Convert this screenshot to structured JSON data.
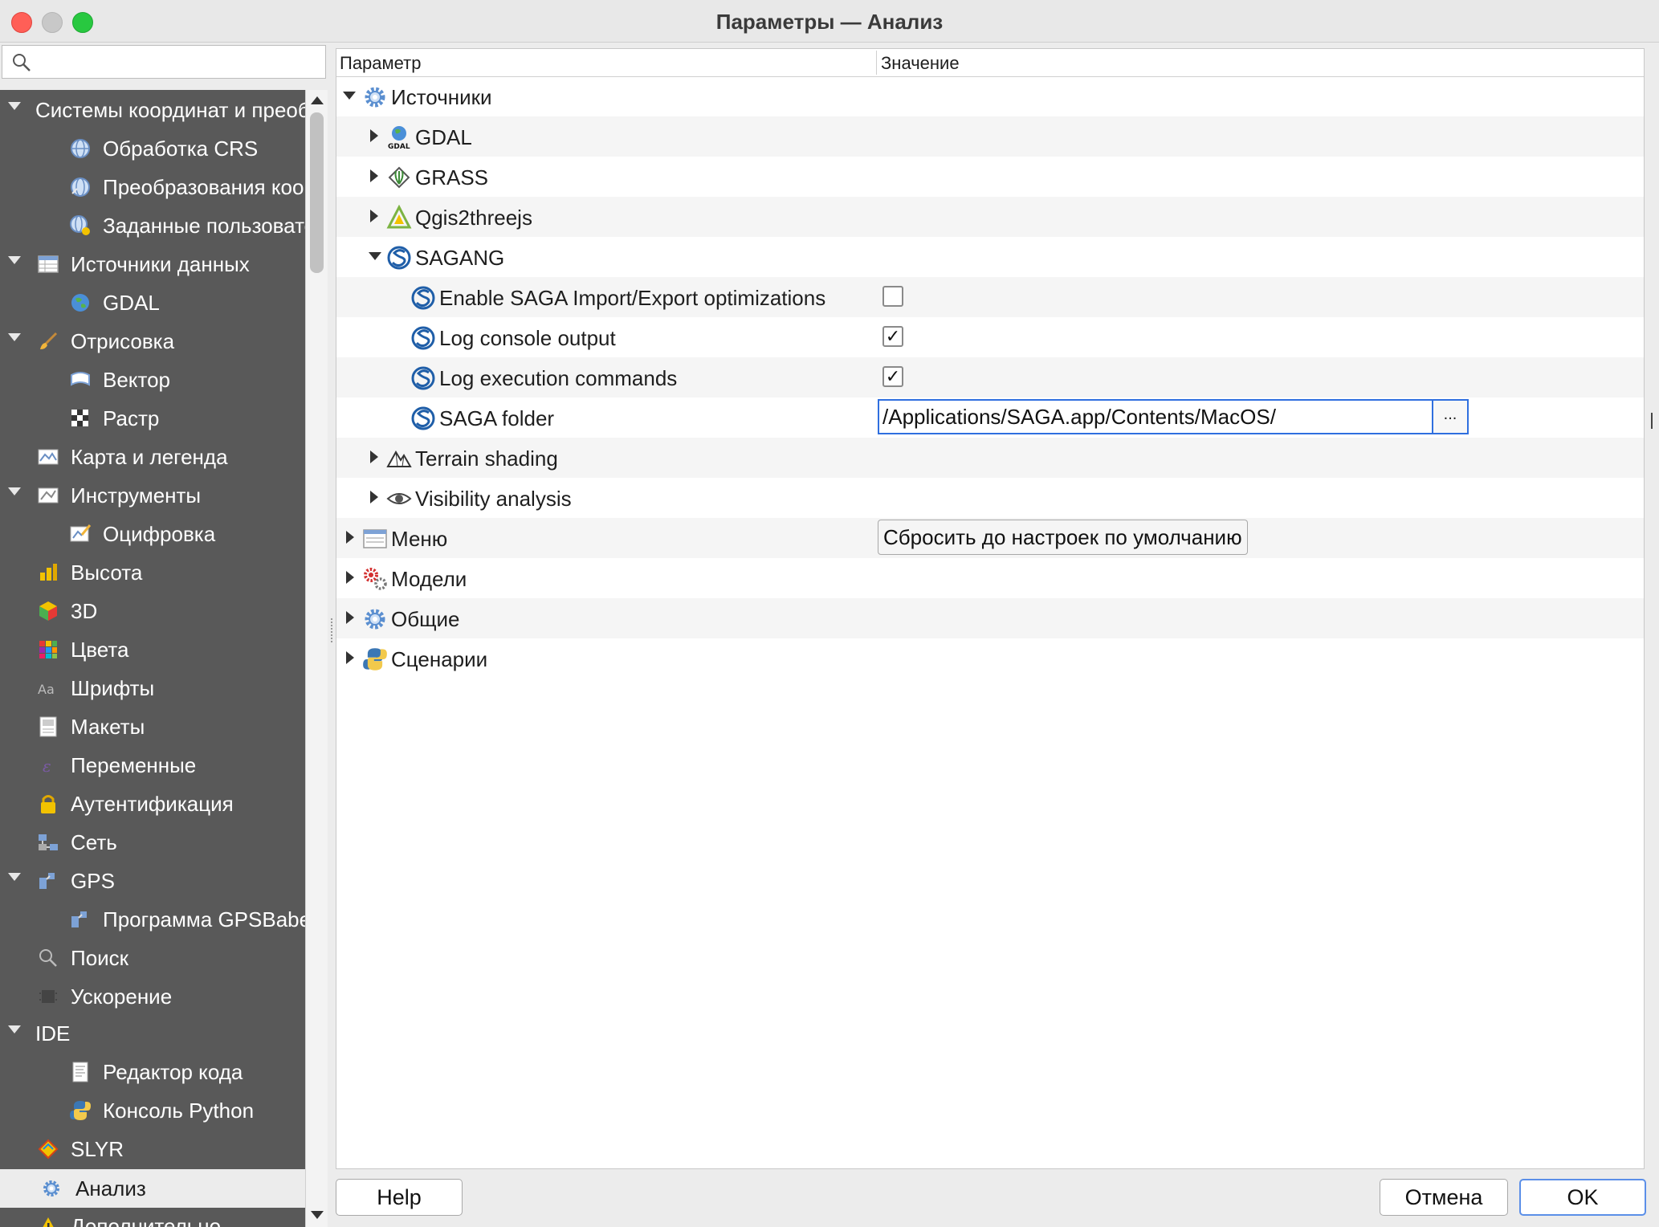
{
  "window": {
    "title": "Параметры — Анализ"
  },
  "search": {
    "placeholder": ""
  },
  "sidebar": {
    "items": [
      {
        "label": "Системы координат и преоб",
        "icon": "crs-icon",
        "expanded": true
      },
      {
        "label": "Обработка CRS",
        "icon": "globe-icon"
      },
      {
        "label": "Преобразования координат",
        "icon": "globe-transform-icon"
      },
      {
        "label": "Заданные пользователем",
        "icon": "globe-star-icon"
      },
      {
        "label": "Источники данных",
        "icon": "table-icon",
        "expanded": true
      },
      {
        "label": "GDAL",
        "icon": "gdal-globe-icon"
      },
      {
        "label": "Отрисовка",
        "icon": "brush-icon",
        "expanded": true
      },
      {
        "label": "Вектор",
        "icon": "vector-icon"
      },
      {
        "label": "Растр",
        "icon": "raster-icon"
      },
      {
        "label": "Карта и легенда",
        "icon": "map-legend-icon"
      },
      {
        "label": "Инструменты",
        "icon": "tools-icon",
        "expanded": true
      },
      {
        "label": "Оцифровка",
        "icon": "digitize-icon"
      },
      {
        "label": "Высота",
        "icon": "elevation-icon"
      },
      {
        "label": "3D",
        "icon": "cube-icon"
      },
      {
        "label": "Цвета",
        "icon": "colors-icon"
      },
      {
        "label": "Шрифты",
        "icon": "fonts-icon"
      },
      {
        "label": "Макеты",
        "icon": "layouts-icon"
      },
      {
        "label": "Переменные",
        "icon": "variables-icon"
      },
      {
        "label": "Аутентификация",
        "icon": "lock-icon"
      },
      {
        "label": "Сеть",
        "icon": "network-icon"
      },
      {
        "label": "GPS",
        "icon": "gps-icon",
        "expanded": true
      },
      {
        "label": "Программа GPSBabel",
        "icon": "gps-icon"
      },
      {
        "label": "Поиск",
        "icon": "search-icon"
      },
      {
        "label": "Ускорение",
        "icon": "chip-icon"
      },
      {
        "label": "IDE",
        "icon": "",
        "expanded": true
      },
      {
        "label": "Редактор кода",
        "icon": "code-editor-icon"
      },
      {
        "label": "Консоль Python",
        "icon": "python-icon"
      },
      {
        "label": "SLYR",
        "icon": "slyr-icon"
      },
      {
        "label": "Анализ",
        "icon": "gear-icon",
        "selected": true
      },
      {
        "label": "Дополнительно",
        "icon": "warning-icon"
      }
    ]
  },
  "tree": {
    "header_param": "Параметр",
    "header_value": "Значение",
    "rows": [
      {
        "label": "Источники",
        "icon": "gear-icon"
      },
      {
        "label": "GDAL",
        "icon": "gdal-icon"
      },
      {
        "label": "GRASS",
        "icon": "grass-icon"
      },
      {
        "label": "Qgis2threejs",
        "icon": "qgis2threejs-icon"
      },
      {
        "label": "SAGANG",
        "icon": "saga-icon"
      },
      {
        "label": "Enable SAGA Import/Export optimizations",
        "icon": "saga-icon",
        "checked": false
      },
      {
        "label": "Log console output",
        "icon": "saga-icon",
        "checked": true
      },
      {
        "label": "Log execution commands",
        "icon": "saga-icon",
        "checked": true
      },
      {
        "label": "SAGA folder",
        "icon": "saga-icon"
      },
      {
        "label": "Terrain shading",
        "icon": "terrain-icon"
      },
      {
        "label": "Visibility analysis",
        "icon": "eye-icon"
      },
      {
        "label": "Меню",
        "icon": "menu-icon"
      },
      {
        "label": "Модели",
        "icon": "models-icon"
      },
      {
        "label": "Общие",
        "icon": "gear-icon"
      },
      {
        "label": "Сценарии",
        "icon": "python-icon"
      }
    ],
    "checkmark": "✓",
    "saga_folder_value": "/Applications/SAGA.app/Contents/MacOS/",
    "browse_label": "...",
    "reset_label": "Сбросить до настроек по умолчанию"
  },
  "buttons": {
    "help": "Help",
    "cancel": "Отмена",
    "ok": "OK"
  },
  "colors": {
    "sidebar_bg": "#595959",
    "focus_blue": "#2f6fdf",
    "saga_blue": "#1f5ea8"
  }
}
